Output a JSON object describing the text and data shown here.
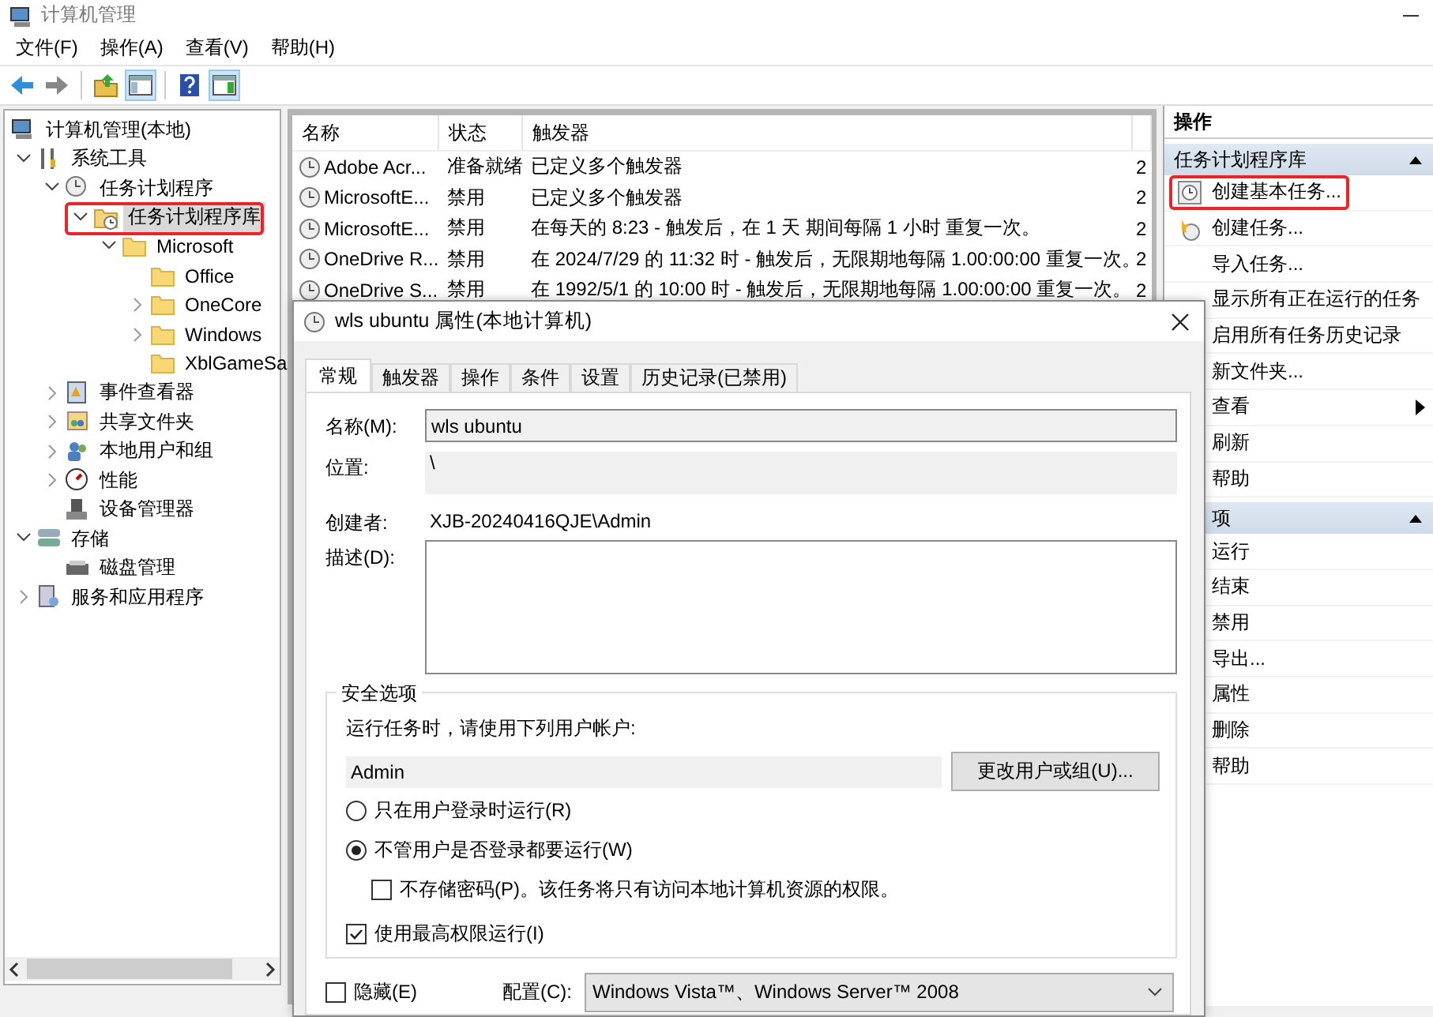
{
  "window": {
    "title": "计算机管理"
  },
  "menu": [
    {
      "label": "文件(F)"
    },
    {
      "label": "操作(A)"
    },
    {
      "label": "查看(V)"
    },
    {
      "label": "帮助(H)"
    }
  ],
  "toolbar": [
    {
      "kind": "back",
      "pressed": false
    },
    {
      "kind": "forward",
      "pressed": false
    },
    {
      "kind": "up",
      "pressed": false
    },
    {
      "kind": "tree-pane",
      "pressed": true
    },
    {
      "kind": "help",
      "pressed": false
    },
    {
      "kind": "action-pane",
      "pressed": true
    }
  ],
  "tree": {
    "items": [
      {
        "label": "计算机管理(本地)",
        "kind": "computer",
        "selected": false,
        "children": [
          {
            "label": "系统工具",
            "kind": "tools",
            "expanded": true,
            "selected": false,
            "children": [
              {
                "label": "任务计划程序",
                "kind": "clock",
                "expanded": true,
                "selected": false,
                "children": [
                  {
                    "label": "任务计划程序库",
                    "kind": "library",
                    "expanded": true,
                    "selected": true,
                    "highlighted": true,
                    "children": [
                      {
                        "label": "Microsoft",
                        "kind": "folder",
                        "expanded": true,
                        "selected": false,
                        "children": [
                          {
                            "label": "Office",
                            "kind": "folder",
                            "selected": false
                          },
                          {
                            "label": "OneCore",
                            "kind": "folder",
                            "expanded": false,
                            "selected": false
                          },
                          {
                            "label": "Windows",
                            "kind": "folder",
                            "expanded": false,
                            "selected": false
                          },
                          {
                            "label": "XblGameSa",
                            "kind": "folder",
                            "selected": false
                          }
                        ]
                      }
                    ]
                  }
                ]
              },
              {
                "label": "事件查看器",
                "kind": "events",
                "expanded": false,
                "selected": false
              },
              {
                "label": "共享文件夹",
                "kind": "share",
                "expanded": false,
                "selected": false
              },
              {
                "label": "本地用户和组",
                "kind": "users",
                "expanded": false,
                "selected": false
              },
              {
                "label": "性能",
                "kind": "perf",
                "expanded": false,
                "selected": false
              },
              {
                "label": "设备管理器",
                "kind": "device",
                "selected": false
              }
            ]
          },
          {
            "label": "存储",
            "kind": "storage",
            "expanded": true,
            "selected": false,
            "children": [
              {
                "label": "磁盘管理",
                "kind": "disk",
                "selected": false
              }
            ]
          },
          {
            "label": "服务和应用程序",
            "kind": "services",
            "expanded": false,
            "selected": false
          }
        ]
      }
    ]
  },
  "table": {
    "columns": [
      "名称",
      "状态",
      "触发器"
    ],
    "rows": [
      {
        "name": "Adobe Acr...",
        "status": "准备就绪",
        "trigger": "已定义多个触发器",
        "column_4": "2"
      },
      {
        "name": "MicrosoftE...",
        "status": "禁用",
        "trigger": "已定义多个触发器",
        "column_4": "2"
      },
      {
        "name": "MicrosoftE...",
        "status": "禁用",
        "trigger": "在每天的 8:23 - 触发后，在 1 天 期间每隔 1 小时 重复一次。",
        "column_4": "2"
      },
      {
        "name": "OneDrive R...",
        "status": "禁用",
        "trigger": "在 2024/7/29 的 11:32 时 - 触发后，无限期地每隔 1.00:00:00 重复一次。",
        "column_4": "2"
      },
      {
        "name": "OneDrive S...",
        "status": "禁用",
        "trigger": "在 1992/5/1 的 10:00 时 - 触发后，无限期地每隔 1.00:00:00 重复一次。",
        "column_4": "2"
      }
    ]
  },
  "actions": {
    "title": "操作",
    "sections": [
      {
        "title": "任务计划程序库",
        "expanded": true,
        "items": [
          {
            "label": "创建基本任务...",
            "kind": "basic-task",
            "highlighted": true
          },
          {
            "label": "创建任务...",
            "kind": "new-task",
            "highlighted": false
          },
          {
            "label": "导入任务...",
            "kind": "plain",
            "highlighted": false
          },
          {
            "label": "显示所有正在运行的任务",
            "kind": "plain",
            "highlighted": false
          },
          {
            "label": "启用所有任务历史记录",
            "kind": "plain",
            "highlighted": false
          },
          {
            "label": "新文件夹...",
            "kind": "plain",
            "highlighted": false
          },
          {
            "label": "查看",
            "kind": "submenu",
            "highlighted": false
          },
          {
            "label": "刷新",
            "kind": "plain",
            "highlighted": false
          },
          {
            "label": "帮助",
            "kind": "plain",
            "highlighted": false
          }
        ]
      },
      {
        "title": "项",
        "expanded": true,
        "items": [
          {
            "label": "运行",
            "kind": "plain",
            "highlighted": false
          },
          {
            "label": "结束",
            "kind": "plain",
            "highlighted": false
          },
          {
            "label": "禁用",
            "kind": "plain",
            "highlighted": false
          },
          {
            "label": "导出...",
            "kind": "plain",
            "highlighted": false
          },
          {
            "label": "属性",
            "kind": "plain",
            "highlighted": false
          },
          {
            "label": "删除",
            "kind": "plain",
            "highlighted": false
          },
          {
            "label": "帮助",
            "kind": "plain",
            "highlighted": false
          }
        ]
      }
    ]
  },
  "dialog": {
    "title": "wls ubuntu 属性(本地计算机)",
    "tabs": [
      {
        "label": "常规",
        "selected": true
      },
      {
        "label": "触发器",
        "selected": false
      },
      {
        "label": "操作",
        "selected": false
      },
      {
        "label": "条件",
        "selected": false
      },
      {
        "label": "设置",
        "selected": false
      },
      {
        "label": "历史记录(已禁用)",
        "selected": false
      }
    ],
    "name_label": "名称(M):",
    "name_value": "wls ubuntu",
    "location_label": "位置:",
    "location_value": "\\",
    "author_label": "创建者:",
    "author_value": "XJB-20240416QJE\\Admin",
    "description_label": "描述(D):",
    "security": {
      "title": "安全选项",
      "account_prompt": "运行任务时，请使用下列用户帐户:",
      "account": "Admin",
      "change_button": "更改用户或组(U)...",
      "options": [
        {
          "kind": "radio",
          "label": "只在用户登录时运行(R)",
          "selected": false
        },
        {
          "kind": "radio",
          "label": "不管用户是否登录都要运行(W)",
          "selected": true
        },
        {
          "kind": "sub-checkbox",
          "label": "不存储密码(P)。该任务将只有访问本地计算机资源的权限。",
          "checked": false
        },
        {
          "kind": "checkbox",
          "label": "使用最高权限运行(I)",
          "checked": true
        }
      ]
    },
    "hidden": {
      "label": "隐藏(E)",
      "checked": false
    },
    "config_label": "配置(C):",
    "config_value": "Windows Vista™、Windows Server™ 2008"
  }
}
